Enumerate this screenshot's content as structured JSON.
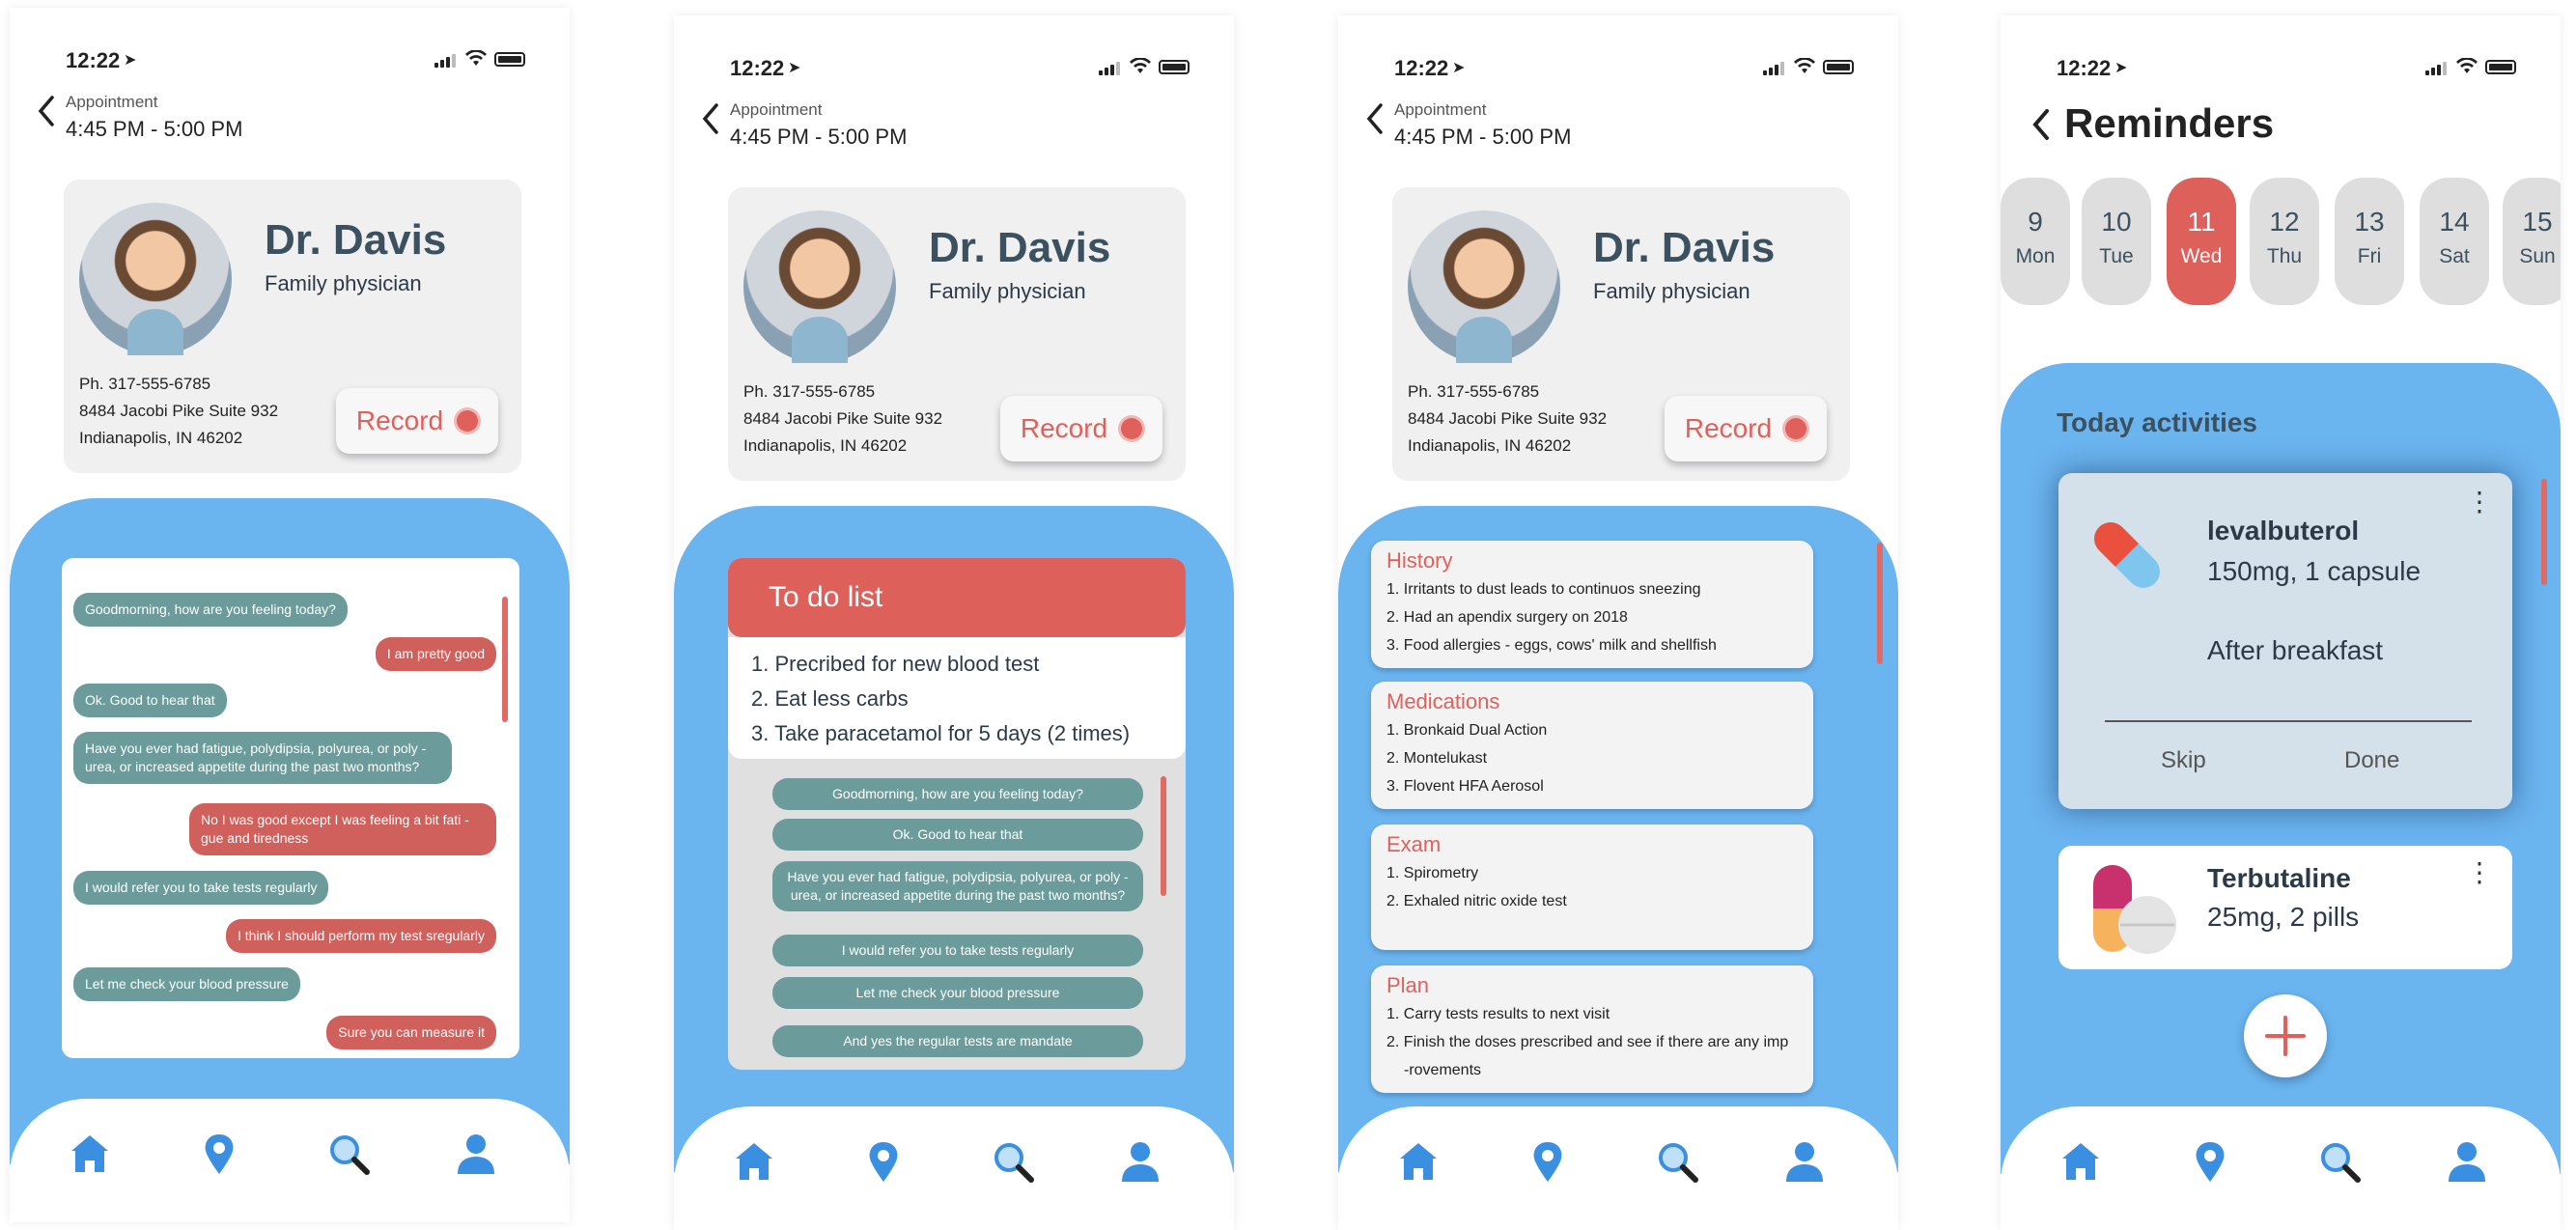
{
  "status": {
    "time": "12:22"
  },
  "appointment": {
    "label": "Appointment",
    "time_range": "4:45 PM - 5:00 PM"
  },
  "doctor": {
    "name": "Dr. Davis",
    "role": "Family physician",
    "phone": "Ph.  317-555-6785",
    "address1": "8484 Jacobi Pike Suite 932",
    "address2": "Indianapolis, IN 46202",
    "record_label": "Record"
  },
  "chat": [
    {
      "from": "doctor",
      "text": "Goodmorning, how are you feeling today?"
    },
    {
      "from": "patient",
      "text": "I am pretty good"
    },
    {
      "from": "doctor",
      "text": "Ok. Good to hear that"
    },
    {
      "from": "doctor",
      "text": "Have you ever had fatigue, polydipsia, polyurea, or poly -urea, or increased appetite during the past two months?"
    },
    {
      "from": "patient",
      "text": "No I was good except I was feeling a bit fati -gue and tiredness"
    },
    {
      "from": "doctor",
      "text": "I would refer you to take tests regularly"
    },
    {
      "from": "patient",
      "text": "I think I should perform my test sregularly"
    },
    {
      "from": "doctor",
      "text": "Let me check your blood pressure"
    },
    {
      "from": "patient",
      "text": "Sure you can measure it"
    }
  ],
  "todo": {
    "title": "To do list",
    "items": [
      "1. Precribed for new blood test",
      "2. Eat less carbs",
      "3. Take paracetamol for 5 days (2 times)"
    ],
    "messages": [
      "Goodmorning, how are you feeling today?",
      "Ok. Good to hear that",
      "Have you ever had fatigue, polydipsia, polyurea, or poly -urea, or increased appetite during the past two months?",
      "I would refer you to take tests regularly",
      "Let me check your blood pressure",
      "And yes the regular tests are mandate"
    ]
  },
  "sections": [
    {
      "title": "History",
      "lines": [
        "1. Irritants to dust leads to continuos sneezing",
        "2. Had an apendix surgery on 2018",
        "3. Food allergies - eggs, cows' milk and shellfish"
      ]
    },
    {
      "title": "Medications",
      "lines": [
        "1. Bronkaid Dual Action",
        "2. Montelukast",
        "3. Flovent HFA Aerosol"
      ]
    },
    {
      "title": "Exam",
      "lines": [
        "1. Spirometry",
        "2. Exhaled nitric oxide test"
      ]
    },
    {
      "title": "Plan",
      "lines": [
        "1. Carry tests results to next visit",
        "2. Finish the doses prescribed and see if there are any imp",
        "   -rovements"
      ]
    }
  ],
  "reminders": {
    "title": "Reminders",
    "days": [
      {
        "num": "9",
        "day": "Mon"
      },
      {
        "num": "10",
        "day": "Tue"
      },
      {
        "num": "11",
        "day": "Wed",
        "selected": true
      },
      {
        "num": "12",
        "day": "Thu"
      },
      {
        "num": "13",
        "day": "Fri"
      },
      {
        "num": "14",
        "day": "Sat"
      },
      {
        "num": "15",
        "day": "Sun"
      }
    ],
    "today_title": "Today activities",
    "activities": [
      {
        "name": "levalbuterol",
        "dose": "150mg, 1 capsule",
        "note": "After breakfast",
        "skip": "Skip",
        "done": "Done"
      },
      {
        "name": "Terbutaline",
        "dose": "25mg, 2 pills"
      }
    ]
  },
  "colors": {
    "accent_red": "#dd605b",
    "panel_blue": "#6ab4f0",
    "teal_bubble": "#6b9b9b"
  },
  "nav": [
    "home-icon",
    "location-pin-icon",
    "search-icon",
    "profile-icon"
  ]
}
